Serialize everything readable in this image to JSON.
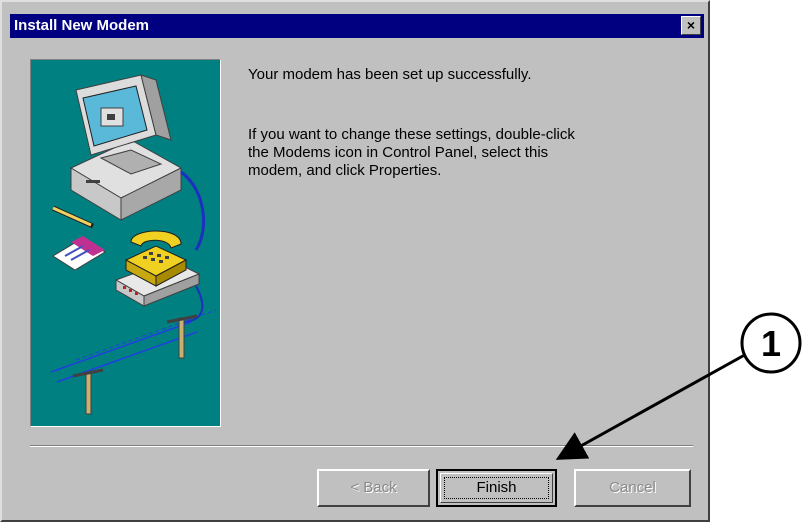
{
  "window": {
    "title": "Install New Modem",
    "close_label": "×"
  },
  "content": {
    "message": "Your modem has been set up successfully.",
    "instructions": "If you want to change these settings, double-click\nthe Modems icon in Control Panel, select this\nmodem, and click Properties."
  },
  "buttons": {
    "back": "< Back",
    "finish": "Finish",
    "cancel": "Cancel"
  },
  "callout": {
    "number": "1"
  },
  "colors": {
    "titlebar": "#000080",
    "dialog": "#c0c0c0",
    "art_background": "#008080"
  },
  "icons": [
    "computer-icon",
    "telephone-icon",
    "modem-icon",
    "pencil-icon",
    "notepad-icon",
    "telephone-pole-icon"
  ]
}
